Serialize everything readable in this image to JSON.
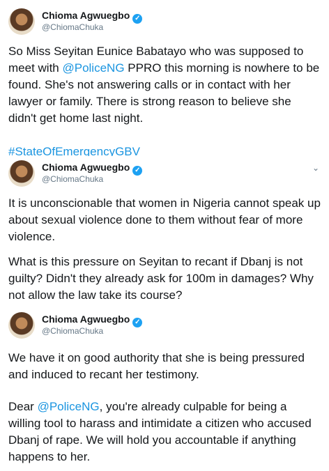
{
  "tweets": [
    {
      "name": "Chioma Agwuegbo",
      "handle": "@ChiomaChuka",
      "text_parts": [
        "So Miss Seyitan Eunice Babatayo who was supposed to meet with ",
        "@PoliceNG",
        " PPRO this morning is nowhere to be found. She's not answering calls or in contact with her lawyer or family. There is strong reason to believe she didn't get home last night."
      ],
      "hashtag": "#StateOfEmergencyGBV"
    },
    {
      "name": "Chioma Agwuegbo",
      "handle": "@ChiomaChuka",
      "paragraph_1": "It is unconscionable that women in Nigeria cannot speak up about sexual violence done to them without fear of more violence.",
      "paragraph_2": "What is this pressure on Seyitan to recant if Dbanj is not guilty? Didn't they already ask for 100m in damages? Why not allow the law take its course?"
    },
    {
      "name": "Chioma Agwuegbo",
      "handle": "@ChiomaChuka",
      "paragraph_1": "We have it on good authority that she is being pressured and induced to recant her testimony.",
      "paragraph_2_parts": [
        "Dear ",
        "@PoliceNG",
        ", you're already culpable for being a willing tool to harass and intimidate a citizen who accused Dbanj of rape. We will hold you accountable if anything happens to her."
      ]
    }
  ],
  "icons": {
    "verified": "verified-badge-icon",
    "menu": "chevron-down-icon"
  },
  "colors": {
    "link": "#1b95e0",
    "verified": "#1da1f2",
    "secondary_text": "#657786"
  }
}
